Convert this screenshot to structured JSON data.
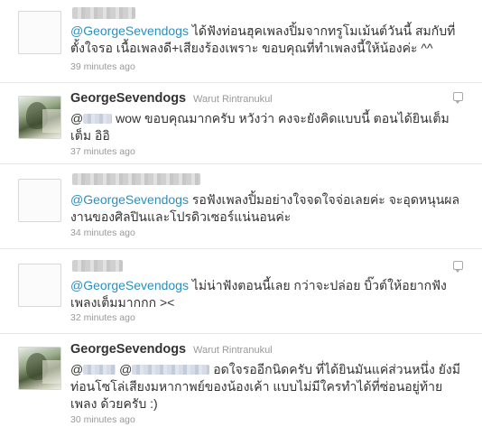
{
  "tweets": [
    {
      "mention": "@GeorgeSevendogs",
      "text": " ได้ฟังท่อนฮุคเพลงปิ้มจากทรูโมเม้นต์วันนี้ สมกับที่ตั้งใจรอ เนื้อเพลงดี+เสียงร้องเพราะ ขอบคุณที่ทำเพลงนี้ให้น้องค่ะ ^^",
      "time": "39 minutes ago"
    },
    {
      "screen_name": "GeorgeSevendogs",
      "full_name": "Warut Rintranukul",
      "mention_prefix": "@",
      "text": " wow ขอบคุณมากครับ หวังว่า คงจะยังคิดแบบนี้ ตอนได้ยินเต็ม เต็ม อิอิ",
      "time": "37 minutes ago"
    },
    {
      "mention": "@GeorgeSevendogs",
      "text": " รอฟังเพลงปิ้มอย่างใจจดใจจ่อเลยค่ะ จะอุดหนุนผลงานของศิลปินและโปรดิวเซอร์แน่นอนค่ะ",
      "time": "34 minutes ago"
    },
    {
      "mention": "@GeorgeSevendogs",
      "text": " ไม่น่าฟังตอนนี้เลย กว่าจะปล่อย บิ๊วต์ให้อยากฟังเพลงเต็มมากกก ><",
      "time": "32 minutes ago"
    },
    {
      "screen_name": "GeorgeSevendogs",
      "full_name": "Warut Rintranukul",
      "mention_prefix": "@",
      "mention_prefix_2": "@",
      "text": " อดใจรออีกนิดครับ ที่ได้ยินมันแค่ส่วนหนึ่ง ยังมีท่อนโซโล่เสียงมหากาพย์ของน้องเค้า แบบไม่มีใครทำได้ที่ซ่อนอยู่ท้ายเพลง ด้วยครับ :)",
      "time": "30 minutes ago"
    }
  ],
  "colors": {
    "mention": "#2a8fbf",
    "meta": "#999999",
    "text": "#333333",
    "divider": "#e6e6e6"
  },
  "icons": [
    "reply-icon"
  ]
}
